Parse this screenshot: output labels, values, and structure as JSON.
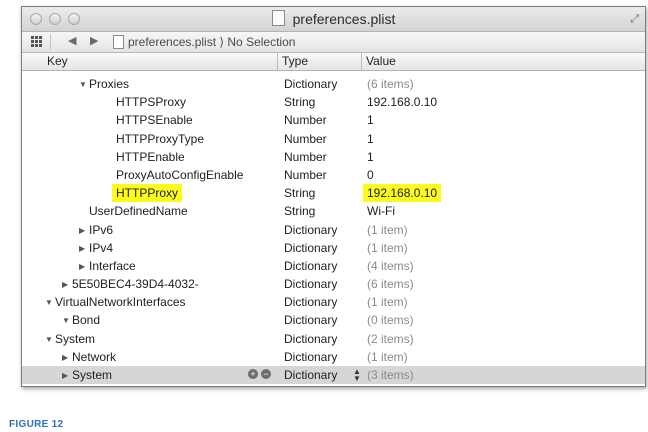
{
  "window": {
    "title": "preferences.plist",
    "icons": {
      "fullscreen": "fullscreen-icon",
      "document": "document-icon"
    }
  },
  "jumpbar": {
    "crumb": "preferences.plist ⟩ No Selection",
    "icons": [
      "grid-icon",
      "back-icon",
      "forward-icon",
      "document-icon"
    ]
  },
  "columns": {
    "key": "Key",
    "type": "Type",
    "value": "Value"
  },
  "rows": [
    {
      "indent": 3,
      "disclosure": "open",
      "key": "Proxies",
      "type": "Dictionary",
      "value": "(6 items)",
      "dim": true
    },
    {
      "indent": 4,
      "disclosure": "none",
      "key": "HTTPSProxy",
      "type": "String",
      "value": "192.168.0.10"
    },
    {
      "indent": 4,
      "disclosure": "none",
      "key": "HTTPSEnable",
      "type": "Number",
      "value": "1"
    },
    {
      "indent": 4,
      "disclosure": "none",
      "key": "HTTPProxyType",
      "type": "Number",
      "value": "1"
    },
    {
      "indent": 4,
      "disclosure": "none",
      "key": "HTTPEnable",
      "type": "Number",
      "value": "1"
    },
    {
      "indent": 4,
      "disclosure": "none",
      "key": "ProxyAutoConfigEnable",
      "type": "Number",
      "value": "0"
    },
    {
      "indent": 4,
      "disclosure": "none",
      "key": "HTTPProxy",
      "type": "String",
      "value": "192.168.0.10",
      "highlight": true
    },
    {
      "indent": 3,
      "disclosure": "none",
      "key": "UserDefinedName",
      "type": "String",
      "value": "Wi-Fi"
    },
    {
      "indent": 3,
      "disclosure": "closed",
      "key": "IPv6",
      "type": "Dictionary",
      "value": "(1 item)",
      "dim": true
    },
    {
      "indent": 3,
      "disclosure": "closed",
      "key": "IPv4",
      "type": "Dictionary",
      "value": "(1 item)",
      "dim": true
    },
    {
      "indent": 3,
      "disclosure": "closed",
      "key": "Interface",
      "type": "Dictionary",
      "value": "(4 items)",
      "dim": true
    },
    {
      "indent": 2,
      "disclosure": "closed",
      "key": "5E50BEC4-39D4-4032-",
      "type": "Dictionary",
      "value": "(6 items)",
      "dim": true
    },
    {
      "indent": 1,
      "disclosure": "open",
      "key": "VirtualNetworkInterfaces",
      "type": "Dictionary",
      "value": "(1 item)",
      "dim": true
    },
    {
      "indent": 2,
      "disclosure": "open",
      "key": "Bond",
      "type": "Dictionary",
      "value": "(0 items)",
      "dim": true
    },
    {
      "indent": 1,
      "disclosure": "open",
      "key": "System",
      "type": "Dictionary",
      "value": "(2 items)",
      "dim": true
    },
    {
      "indent": 2,
      "disclosure": "closed",
      "key": "Network",
      "type": "Dictionary",
      "value": "(1 item)",
      "dim": true
    },
    {
      "indent": 2,
      "disclosure": "closed",
      "key": "System",
      "type": "Dictionary",
      "value": "(3 items)",
      "dim": true,
      "selected": true
    }
  ],
  "caption": "FIGURE 12",
  "colors": {
    "highlight": "#fbfb1e",
    "caption": "#2f6fb7",
    "selected_row": "#d6d6d6"
  }
}
